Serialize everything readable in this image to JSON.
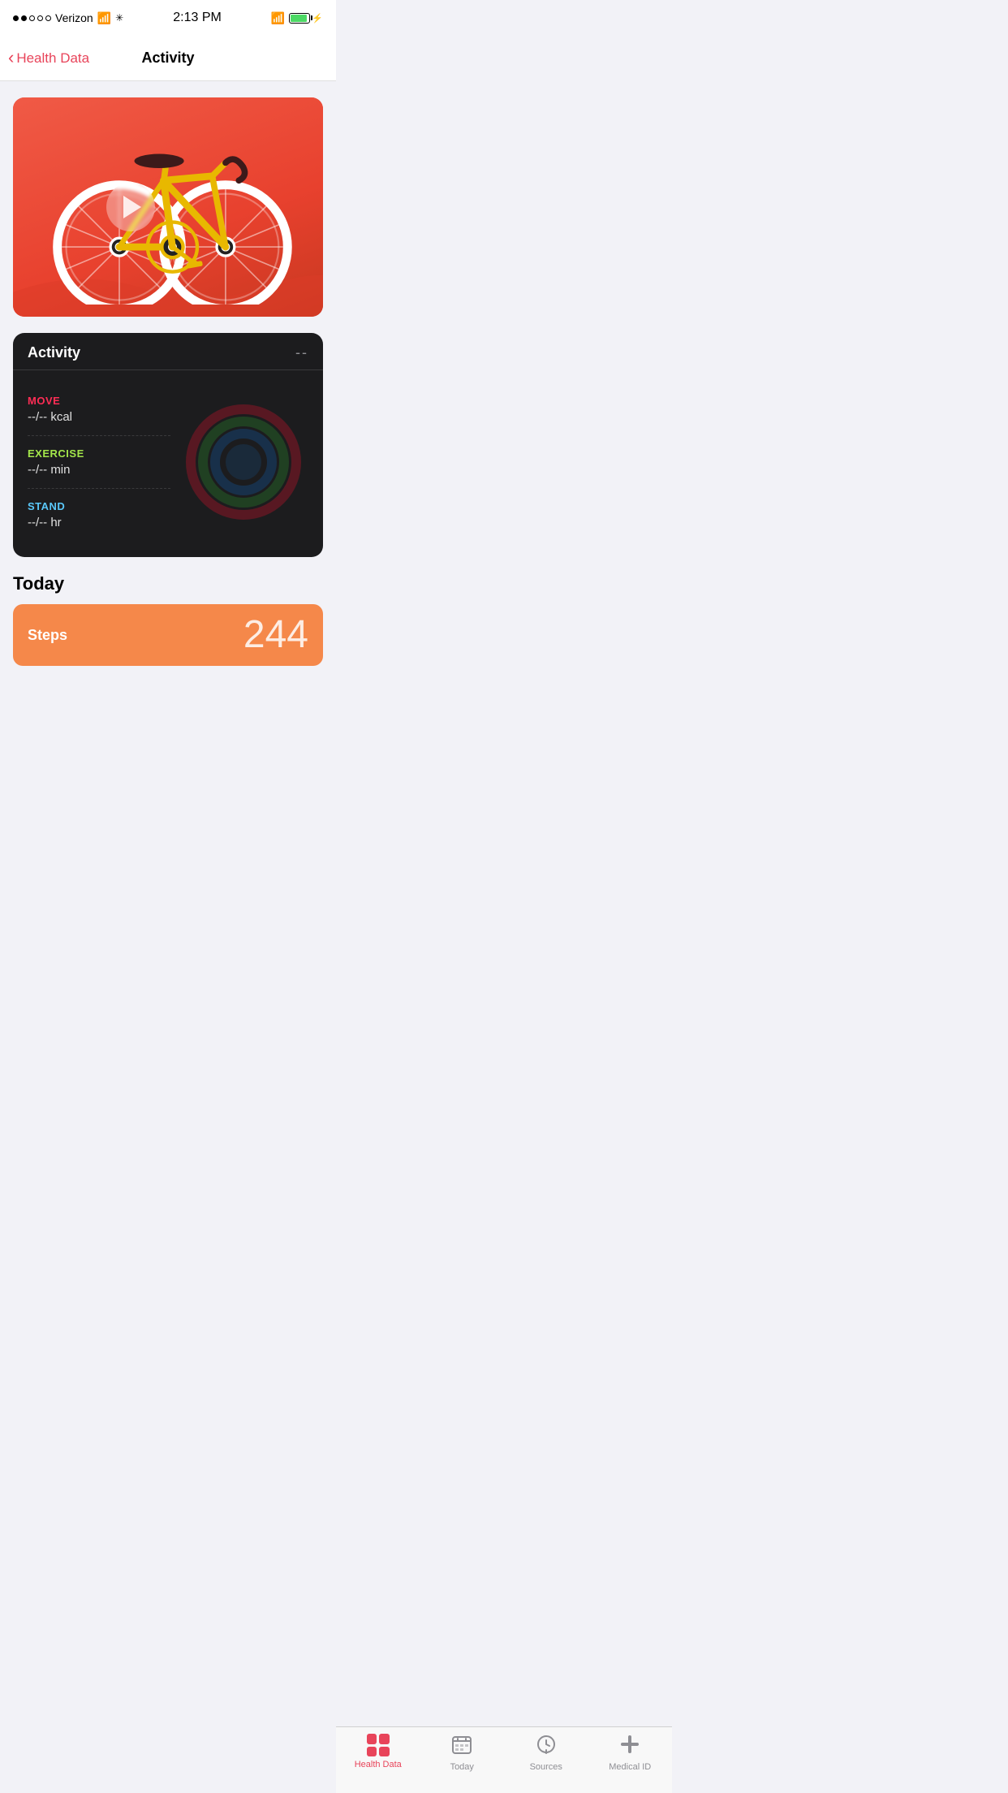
{
  "statusBar": {
    "time": "2:13 PM",
    "carrier": "Verizon",
    "signal_dots": 2,
    "total_dots": 5
  },
  "nav": {
    "back_label": "Health Data",
    "title": "Activity"
  },
  "banner": {
    "alt": "Bicycle activity illustration"
  },
  "activityCard": {
    "title": "Activity",
    "more": "--",
    "metrics": [
      {
        "id": "move",
        "label": "MOVE",
        "value": "--/-- kcal",
        "color": "move"
      },
      {
        "id": "exercise",
        "label": "EXERCISE",
        "value": "--/-- min",
        "color": "exercise"
      },
      {
        "id": "stand",
        "label": "STAND",
        "value": "--/-- hr",
        "color": "stand"
      }
    ]
  },
  "today": {
    "header": "Today",
    "stepsCard": {
      "label": "Steps",
      "value": "244"
    }
  },
  "tabBar": {
    "items": [
      {
        "id": "health-data",
        "label": "Health Data",
        "active": true,
        "icon": "squares"
      },
      {
        "id": "today",
        "label": "Today",
        "active": false,
        "icon": "calendar"
      },
      {
        "id": "sources",
        "label": "Sources",
        "active": false,
        "icon": "download"
      },
      {
        "id": "medical-id",
        "label": "Medical ID",
        "active": false,
        "icon": "cross"
      }
    ]
  }
}
